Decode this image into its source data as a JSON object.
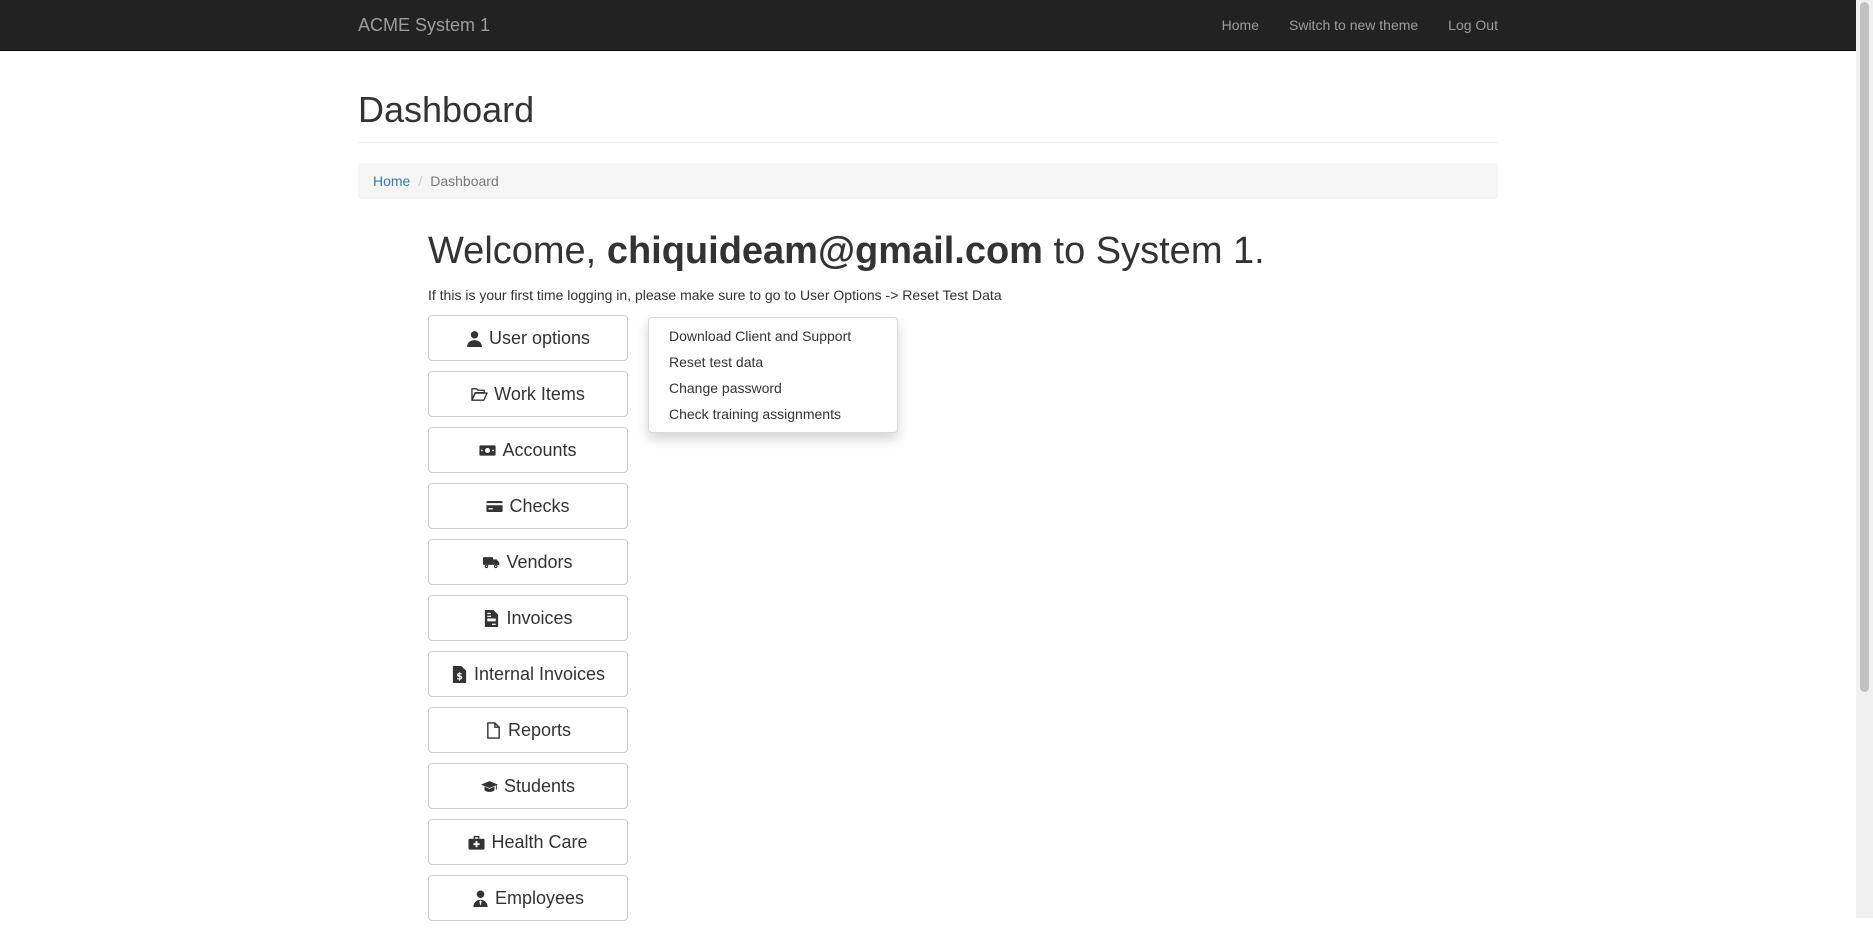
{
  "navbar": {
    "brand": "ACME System 1",
    "links": [
      "Home",
      "Switch to new theme",
      "Log Out"
    ]
  },
  "page": {
    "title": "Dashboard"
  },
  "breadcrumb": {
    "home": "Home",
    "separator": "/",
    "current": "Dashboard"
  },
  "welcome": {
    "prefix": "Welcome,",
    "user": "chiquideam@gmail.com",
    "suffix": "to System 1.",
    "hint": "If this is your first time logging in, please make sure to go to User Options -> Reset Test Data"
  },
  "menu": [
    {
      "label": "User options",
      "icon": "user-icon"
    },
    {
      "label": "Work Items",
      "icon": "folder-open-icon"
    },
    {
      "label": "Accounts",
      "icon": "money-bill-icon"
    },
    {
      "label": "Checks",
      "icon": "credit-card-icon"
    },
    {
      "label": "Vendors",
      "icon": "truck-icon"
    },
    {
      "label": "Invoices",
      "icon": "file-invoice-icon"
    },
    {
      "label": "Internal Invoices",
      "icon": "file-invoice-dollar-icon"
    },
    {
      "label": "Reports",
      "icon": "file-icon"
    },
    {
      "label": "Students",
      "icon": "graduation-cap-icon"
    },
    {
      "label": "Health Care",
      "icon": "medkit-icon"
    },
    {
      "label": "Employees",
      "icon": "user-tie-icon"
    }
  ],
  "dropdown": {
    "items": [
      "Download Client and Support",
      "Reset test data",
      "Change password",
      "Check training assignments"
    ]
  }
}
